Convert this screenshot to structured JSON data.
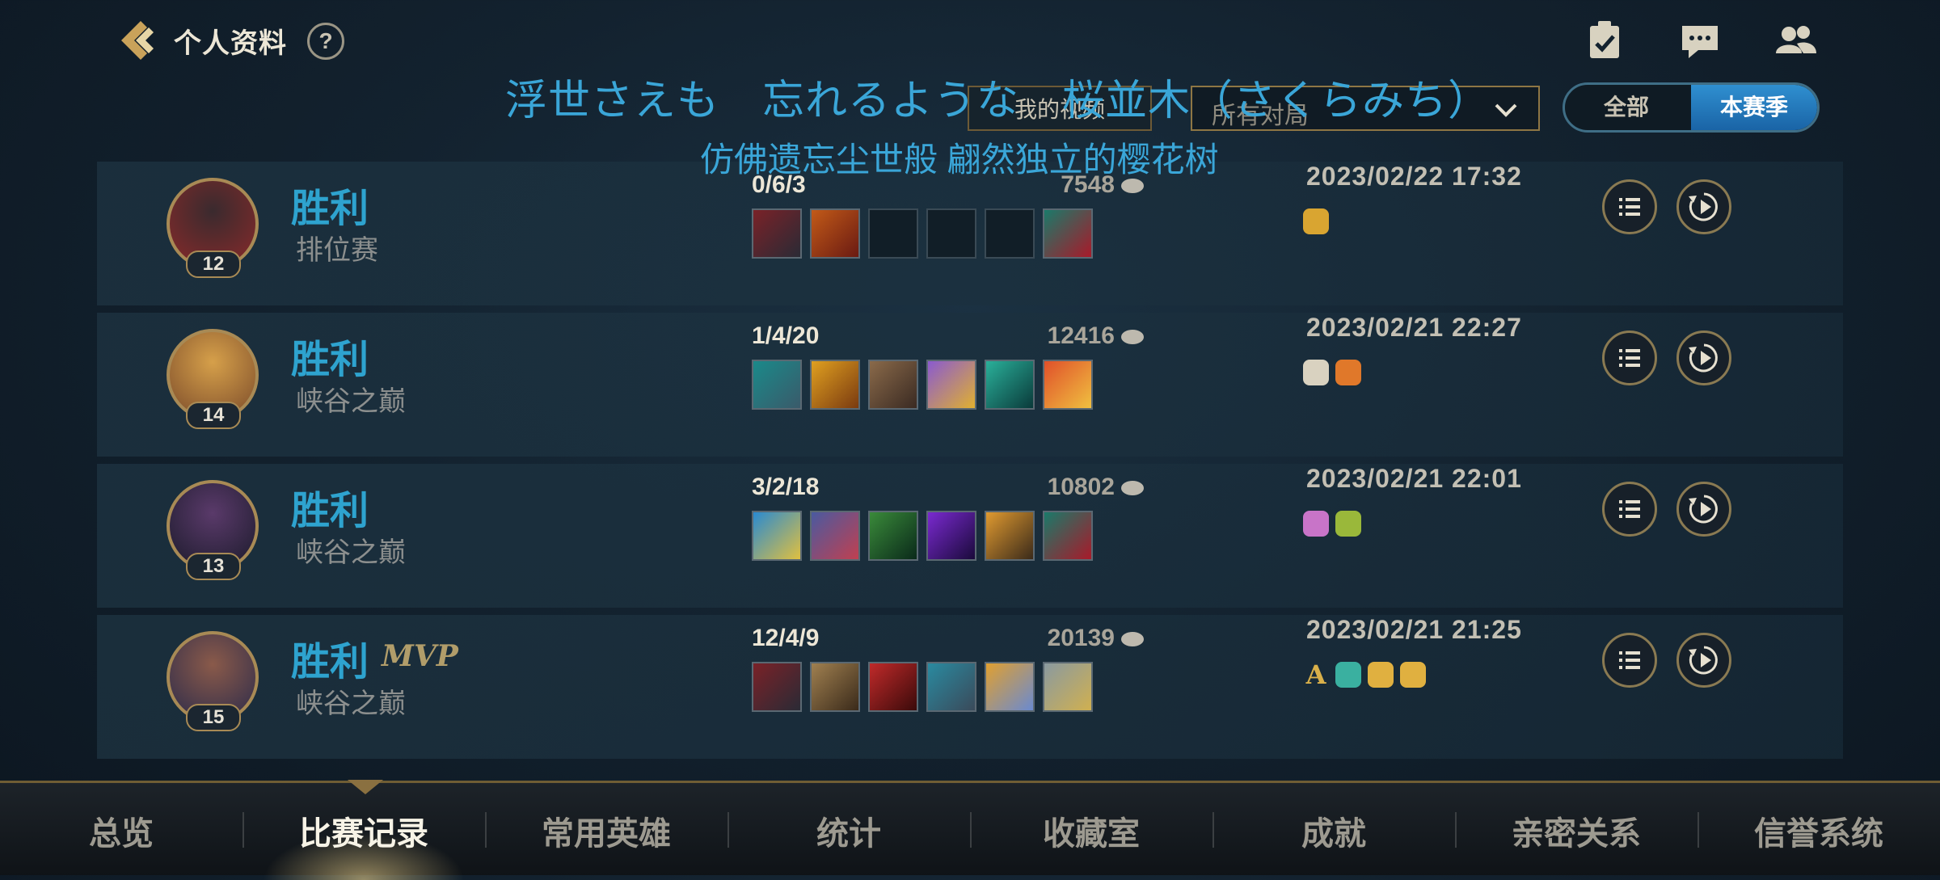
{
  "header": {
    "title": "个人资料",
    "help_label": "?"
  },
  "overlay": {
    "lyric_jp": "浮世さえも　忘れるような　桜並木（さくらみち）",
    "lyric_cn": "仿佛遗忘尘世般 翩然独立的樱花树"
  },
  "filters": {
    "video_label": "我的视频",
    "match_filter_value": "所有对局",
    "toggle_all": "全部",
    "toggle_season": "本赛季",
    "toggle_selected": "本赛季"
  },
  "matches": [
    {
      "result": "胜利",
      "mvp": "",
      "mode": "排位赛",
      "level": "12",
      "kda": "0/6/3",
      "gold": "7548",
      "datetime": "2023/02/22 17:32",
      "avatar_colors": [
        "#3a2a2e",
        "#8a2a2a"
      ],
      "items": [
        {
          "colors": [
            "#7a2228",
            "#2a2a35"
          ]
        },
        {
          "colors": [
            "#c25a18",
            "#6a1a12"
          ]
        },
        {
          "empty": true
        },
        {
          "empty": true
        },
        {
          "empty": true
        },
        {
          "colors": [
            "#1a7a6a",
            "#a81a2a"
          ]
        }
      ],
      "badges": [
        {
          "color": "#d9a531"
        }
      ]
    },
    {
      "result": "胜利",
      "mvp": "",
      "mode": "峡谷之巅",
      "level": "14",
      "kda": "1/4/20",
      "gold": "12416",
      "datetime": "2023/02/21 22:27",
      "avatar_colors": [
        "#d6a04a",
        "#7a4a2a"
      ],
      "items": [
        {
          "colors": [
            "#1a8a8a",
            "#3a5a6a"
          ]
        },
        {
          "colors": [
            "#e0a020",
            "#7a3a10"
          ]
        },
        {
          "colors": [
            "#8a6a4a",
            "#3a2a22"
          ]
        },
        {
          "colors": [
            "#8a5ad0",
            "#e0b030"
          ]
        },
        {
          "colors": [
            "#2ab09a",
            "#0a3a3a"
          ]
        },
        {
          "colors": [
            "#e0502a",
            "#f0c040"
          ]
        }
      ],
      "badges": [
        {
          "color": "#d9d2c0"
        },
        {
          "color": "#e0782a"
        }
      ]
    },
    {
      "result": "胜利",
      "mvp": "",
      "mode": "峡谷之巅",
      "level": "13",
      "kda": "3/2/18",
      "gold": "10802",
      "datetime": "2023/02/21 22:01",
      "avatar_colors": [
        "#5a3a6a",
        "#1a1a2a"
      ],
      "items": [
        {
          "colors": [
            "#2a8ad0",
            "#e0c040"
          ]
        },
        {
          "colors": [
            "#4a5aa0",
            "#c04050"
          ]
        },
        {
          "colors": [
            "#3a8a3a",
            "#0a2a1a"
          ]
        },
        {
          "colors": [
            "#7a2ad0",
            "#1a0a3a"
          ]
        },
        {
          "colors": [
            "#e09a30",
            "#3a2a1a"
          ]
        },
        {
          "colors": [
            "#1a7a6a",
            "#a81a2a"
          ]
        }
      ],
      "badges": [
        {
          "color": "#c874c8"
        },
        {
          "color": "#9ab83a"
        }
      ]
    },
    {
      "result": "胜利",
      "mvp": "MVP",
      "mode": "峡谷之巅",
      "level": "15",
      "kda": "12/4/9",
      "gold": "20139",
      "datetime": "2023/02/21 21:25",
      "avatar_colors": [
        "#8a5a4a",
        "#2a2a4a"
      ],
      "items": [
        {
          "colors": [
            "#7a2228",
            "#2a2a35"
          ]
        },
        {
          "colors": [
            "#a08050",
            "#3a2a1a"
          ]
        },
        {
          "colors": [
            "#c02a2a",
            "#3a0a0a"
          ]
        },
        {
          "colors": [
            "#2a8aa0",
            "#3a4a5a"
          ]
        },
        {
          "colors": [
            "#e0a030",
            "#6a8ad0"
          ]
        },
        {
          "colors": [
            "#8a9aa0",
            "#d0b050"
          ]
        }
      ],
      "badges": [
        {
          "color": "#d9b04a",
          "text": "A"
        },
        {
          "color": "#3ab0a0"
        },
        {
          "color": "#e0b040"
        },
        {
          "color": "#e0b040"
        }
      ]
    }
  ],
  "tabs": [
    "总览",
    "比赛记录",
    "常用英雄",
    "统计",
    "收藏室",
    "成就",
    "亲密关系",
    "信誉系统"
  ],
  "active_tab": "比赛记录",
  "colors": {
    "accent_blue": "#2ea3cf",
    "gold_border": "#a88a55"
  }
}
